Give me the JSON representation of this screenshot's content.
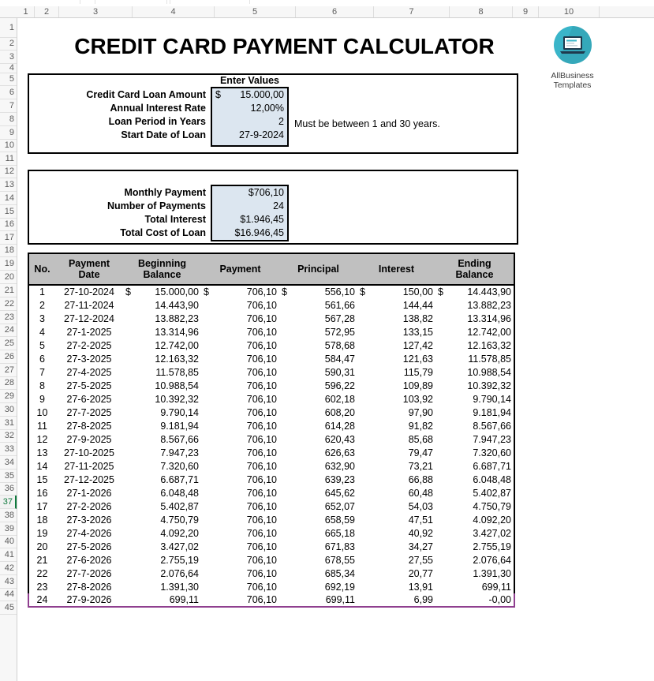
{
  "spreadsheet": {
    "column_headers": [
      "1",
      "2",
      "3",
      "4",
      "5",
      "6",
      "7",
      "8",
      "9",
      "10"
    ],
    "row_headers": [
      "1",
      "2",
      "3",
      "4",
      "5",
      "6",
      "7",
      "8",
      "9",
      "10",
      "11",
      "12",
      "13",
      "14",
      "15",
      "16",
      "17",
      "18",
      "19",
      "20",
      "21",
      "22",
      "23",
      "24",
      "25",
      "26",
      "27",
      "28",
      "29",
      "30",
      "31",
      "32",
      "33",
      "34",
      "35",
      "36",
      "37",
      "38",
      "39",
      "40",
      "41",
      "42",
      "43",
      "44",
      "45"
    ],
    "active_row": "37"
  },
  "title": "CREDIT CARD PAYMENT CALCULATOR",
  "logo": {
    "icon": "laptop-icon",
    "line1": "AllBusiness",
    "line2": "Templates"
  },
  "inputs": {
    "header": "Enter Values",
    "note": "Must be between 1 and 30 years.",
    "rows": [
      {
        "label": "Credit Card Loan Amount",
        "currency": "$",
        "value": "15.000,00"
      },
      {
        "label": "Annual Interest Rate",
        "currency": "",
        "value": "12,00%"
      },
      {
        "label": "Loan Period in Years",
        "currency": "",
        "value": "2"
      },
      {
        "label": "Start Date of Loan",
        "currency": "",
        "value": "27-9-2024"
      }
    ]
  },
  "summary": {
    "rows": [
      {
        "label": "Monthly Payment",
        "value": "$706,10"
      },
      {
        "label": "Number of Payments",
        "value": "24"
      },
      {
        "label": "Total Interest",
        "value": "$1.946,45"
      },
      {
        "label": "Total Cost of Loan",
        "value": "$16.946,45"
      }
    ]
  },
  "schedule": {
    "columns": [
      "No.",
      "Payment Date",
      "Beginning Balance",
      "Payment",
      "Principal",
      "Interest",
      "Ending Balance"
    ],
    "currency_symbol": "$",
    "rows": [
      [
        "1",
        "27-10-2024",
        "15.000,00",
        "706,10",
        "556,10",
        "150,00",
        "14.443,90"
      ],
      [
        "2",
        "27-11-2024",
        "14.443,90",
        "706,10",
        "561,66",
        "144,44",
        "13.882,23"
      ],
      [
        "3",
        "27-12-2024",
        "13.882,23",
        "706,10",
        "567,28",
        "138,82",
        "13.314,96"
      ],
      [
        "4",
        "27-1-2025",
        "13.314,96",
        "706,10",
        "572,95",
        "133,15",
        "12.742,00"
      ],
      [
        "5",
        "27-2-2025",
        "12.742,00",
        "706,10",
        "578,68",
        "127,42",
        "12.163,32"
      ],
      [
        "6",
        "27-3-2025",
        "12.163,32",
        "706,10",
        "584,47",
        "121,63",
        "11.578,85"
      ],
      [
        "7",
        "27-4-2025",
        "11.578,85",
        "706,10",
        "590,31",
        "115,79",
        "10.988,54"
      ],
      [
        "8",
        "27-5-2025",
        "10.988,54",
        "706,10",
        "596,22",
        "109,89",
        "10.392,32"
      ],
      [
        "9",
        "27-6-2025",
        "10.392,32",
        "706,10",
        "602,18",
        "103,92",
        "9.790,14"
      ],
      [
        "10",
        "27-7-2025",
        "9.790,14",
        "706,10",
        "608,20",
        "97,90",
        "9.181,94"
      ],
      [
        "11",
        "27-8-2025",
        "9.181,94",
        "706,10",
        "614,28",
        "91,82",
        "8.567,66"
      ],
      [
        "12",
        "27-9-2025",
        "8.567,66",
        "706,10",
        "620,43",
        "85,68",
        "7.947,23"
      ],
      [
        "13",
        "27-10-2025",
        "7.947,23",
        "706,10",
        "626,63",
        "79,47",
        "7.320,60"
      ],
      [
        "14",
        "27-11-2025",
        "7.320,60",
        "706,10",
        "632,90",
        "73,21",
        "6.687,71"
      ],
      [
        "15",
        "27-12-2025",
        "6.687,71",
        "706,10",
        "639,23",
        "66,88",
        "6.048,48"
      ],
      [
        "16",
        "27-1-2026",
        "6.048,48",
        "706,10",
        "645,62",
        "60,48",
        "5.402,87"
      ],
      [
        "17",
        "27-2-2026",
        "5.402,87",
        "706,10",
        "652,07",
        "54,03",
        "4.750,79"
      ],
      [
        "18",
        "27-3-2026",
        "4.750,79",
        "706,10",
        "658,59",
        "47,51",
        "4.092,20"
      ],
      [
        "19",
        "27-4-2026",
        "4.092,20",
        "706,10",
        "665,18",
        "40,92",
        "3.427,02"
      ],
      [
        "20",
        "27-5-2026",
        "3.427,02",
        "706,10",
        "671,83",
        "34,27",
        "2.755,19"
      ],
      [
        "21",
        "27-6-2026",
        "2.755,19",
        "706,10",
        "678,55",
        "27,55",
        "2.076,64"
      ],
      [
        "22",
        "27-7-2026",
        "2.076,64",
        "706,10",
        "685,34",
        "20,77",
        "1.391,30"
      ],
      [
        "23",
        "27-8-2026",
        "1.391,30",
        "706,10",
        "692,19",
        "13,91",
        "699,11"
      ],
      [
        "24",
        "27-9-2026",
        "699,11",
        "706,10",
        "699,11",
        "6,99",
        "-0,00"
      ]
    ]
  },
  "colors": {
    "input_fill": "#dce6f0",
    "header_fill": "#c0c0c0",
    "table_bottom_border": "#8f3f8f",
    "active_row": "#0f7a3d",
    "logo_teal": "#3ab5c9"
  }
}
